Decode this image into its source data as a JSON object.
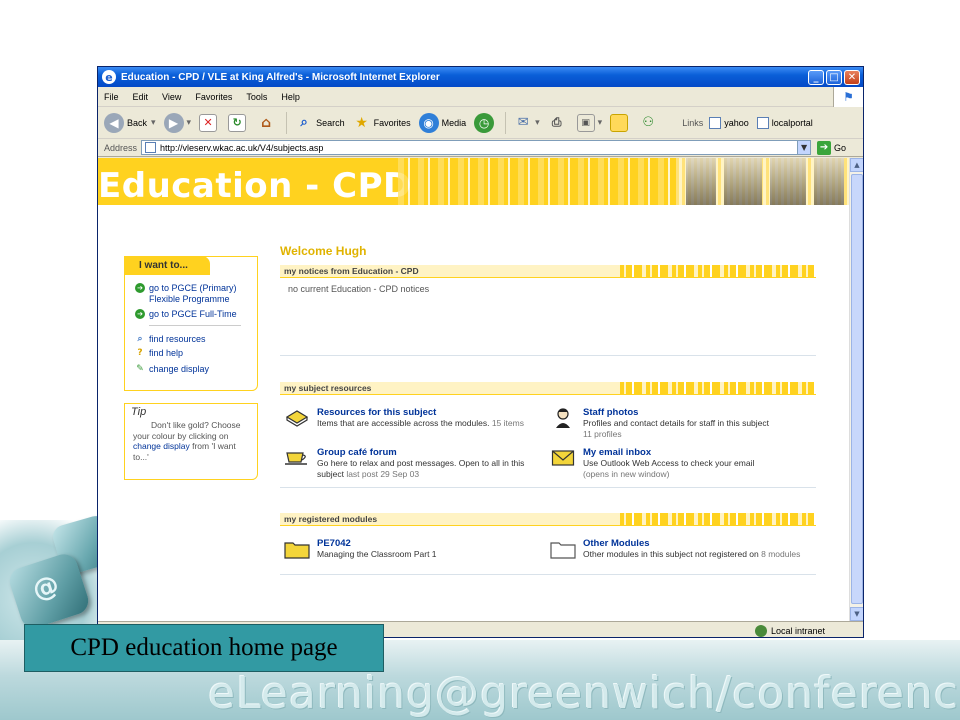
{
  "caption": "CPD education home page",
  "conference_text": "eLearning@greenwich/conference",
  "key_label": "@",
  "window": {
    "title": "Education - CPD / VLE at King Alfred's - Microsoft Internet Explorer",
    "controls": [
      "_",
      "□",
      "✕"
    ]
  },
  "menu": [
    "File",
    "Edit",
    "View",
    "Favorites",
    "Tools",
    "Help"
  ],
  "toolbar": {
    "back": "Back",
    "search": "Search",
    "favorites": "Favorites",
    "media": "Media",
    "links_label": "Links",
    "links": [
      "yahoo",
      "localportal"
    ]
  },
  "address": {
    "label": "Address",
    "url": "http://vleserv.wkac.ac.uk/V4/subjects.asp",
    "go": "Go"
  },
  "status": {
    "zone": "Local intranet"
  },
  "page": {
    "banner_title": "Education - CPD",
    "welcome": "Welcome Hugh",
    "iwant": {
      "heading": "I want to...",
      "items": [
        "go to PGCE (Primary) Flexible Programme",
        "go to PGCE Full-Time",
        "find resources",
        "find help",
        "change display"
      ]
    },
    "tip": {
      "heading": "Tip",
      "text_1": "Don't like gold? Choose your colour by clicking on ",
      "link": "change display",
      "text_2": " from 'I want to...'"
    },
    "notices": {
      "heading": "my notices from Education - CPD",
      "text": "no current Education - CPD notices"
    },
    "subject_resources": {
      "heading": "my subject resources",
      "items": [
        {
          "title": "Resources for this subject",
          "desc": "Items that are accessible across the modules.",
          "meta": "15 items",
          "icon": "book-icon"
        },
        {
          "title": "Staff photos",
          "desc": "Profiles and contact details for staff in this subject",
          "meta": "11 profiles",
          "icon": "person-icon"
        },
        {
          "title": "Group café forum",
          "desc": "Go here to relax and post messages. Open to all in this subject",
          "meta": "last post 29 Sep 03",
          "icon": "coffee-cup-icon"
        },
        {
          "title": "My email inbox",
          "desc": "Use Outlook Web Access to check your email",
          "meta": "(opens in new window)",
          "icon": "envelope-icon"
        }
      ]
    },
    "modules": {
      "heading": "my registered modules",
      "items": [
        {
          "title": "PE7042",
          "desc": "Managing the Classroom Part 1",
          "meta": "",
          "icon": "folder-icon"
        },
        {
          "title": "Other Modules",
          "desc": "Other modules in this subject not registered on",
          "meta": "8 modules",
          "icon": "folder-icon"
        }
      ]
    }
  },
  "colors": {
    "accent_gold": "#ffd21f",
    "link_blue": "#003399",
    "caption_teal": "#329aa3"
  }
}
